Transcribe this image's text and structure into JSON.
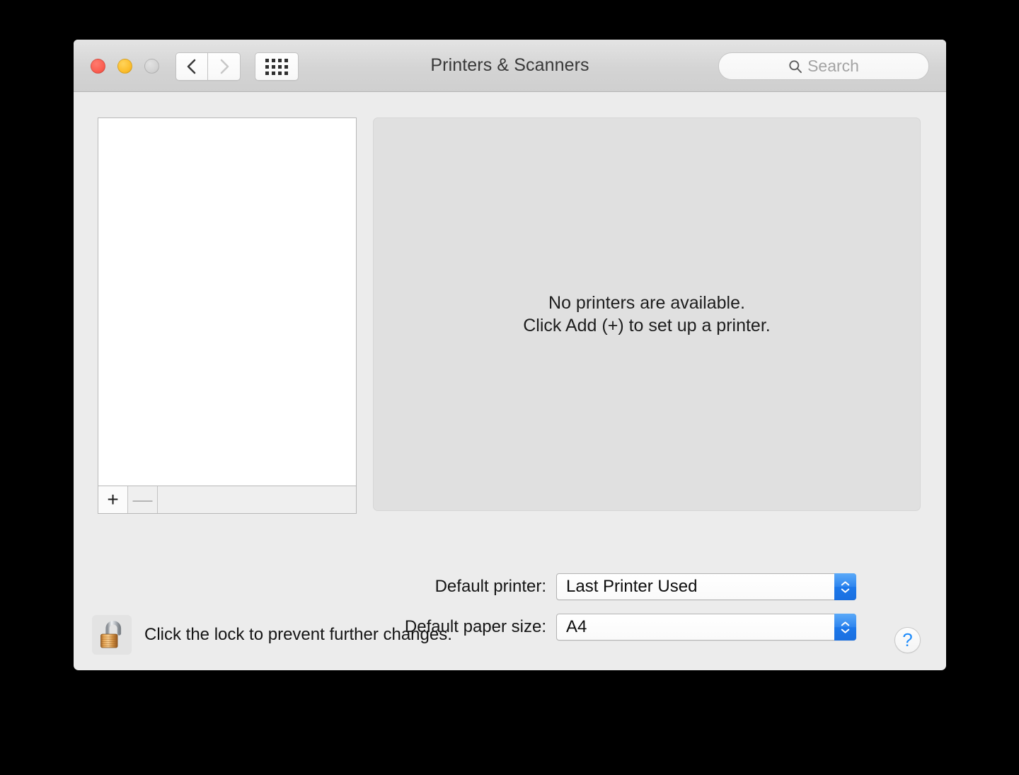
{
  "window": {
    "title": "Printers & Scanners",
    "traffic_lights": {
      "close_label": "close",
      "minimize_label": "minimize",
      "zoom_label": "zoom"
    },
    "colors": {
      "close": "#fb5f52",
      "minimize": "#fcbe2d",
      "zoom": "#d3d3d3",
      "accent_blue": "#1f8cfb",
      "stepper_blue": "#2f86ef",
      "titlebar": "#d4d4d4",
      "window_bg": "#ececec",
      "panel_bg": "#e0e0e0"
    }
  },
  "toolbar": {
    "back_label": "Back",
    "forward_label": "Forward",
    "show_all_label": "Show All"
  },
  "search": {
    "placeholder": "Search",
    "value": "",
    "icon": "search-icon"
  },
  "printer_list": {
    "items": [],
    "add_label": "+",
    "remove_label": "—"
  },
  "info_panel": {
    "line1": "No printers are available.",
    "line2": "Click Add (+) to set up a printer."
  },
  "settings": {
    "default_printer": {
      "label": "Default printer:",
      "value": "Last Printer Used"
    },
    "default_paper_size": {
      "label": "Default paper size:",
      "value": "A4"
    }
  },
  "lock": {
    "icon": "unlocked-padlock-icon",
    "text": "Click the lock to prevent further changes."
  },
  "help": {
    "label": "?"
  }
}
